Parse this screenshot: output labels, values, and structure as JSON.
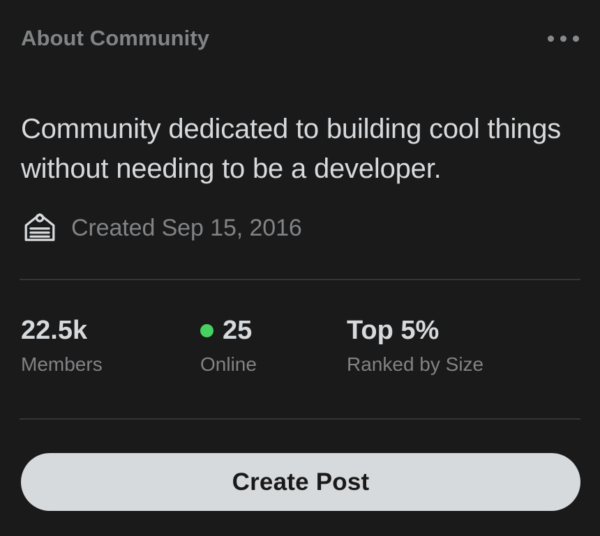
{
  "header": {
    "title": "About Community",
    "menu_icon": "kebab-menu-icon"
  },
  "description": "Community dedicated to building cool things without needing to be a developer.",
  "created": {
    "icon": "cake-icon",
    "text": "Created Sep 15, 2016"
  },
  "stats": [
    {
      "value": "22.5k",
      "label": "Members",
      "has_dot": false
    },
    {
      "value": "25",
      "label": "Online",
      "has_dot": true
    },
    {
      "value": "Top 5%",
      "label": "Ranked by Size",
      "has_dot": false
    }
  ],
  "actions": {
    "create_post_label": "Create Post"
  },
  "colors": {
    "background": "#1a1a1b",
    "primary_text": "#d7dadc",
    "muted_text": "#818384",
    "divider": "#343536",
    "online_green": "#46d160",
    "button_bg": "#d7dadc",
    "button_text": "#1a1a1b"
  }
}
